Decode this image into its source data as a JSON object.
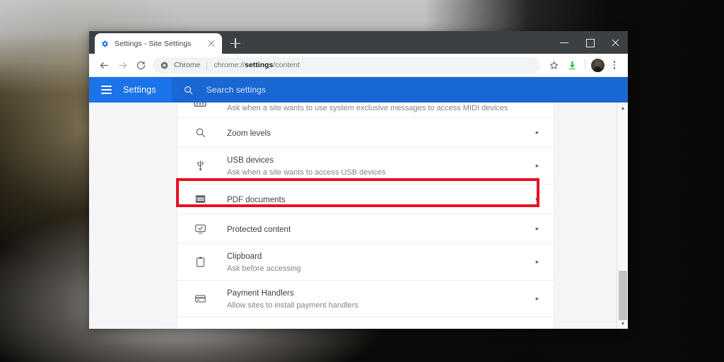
{
  "browser": {
    "tab": {
      "title": "Settings - Site Settings",
      "favicon": "gear-icon",
      "close_label": "×"
    },
    "new_tab_label": "+",
    "window_controls": {
      "minimize": "–",
      "maximize": "□",
      "close": "×"
    },
    "toolbar": {
      "back": "←",
      "forward": "→",
      "reload": "⟳",
      "omnibox": {
        "security_icon": "chrome-info-icon",
        "scheme_label": "Chrome",
        "url_prefix": "chrome://",
        "url_bold": "settings",
        "url_suffix": "/content"
      },
      "bookmark": "☆",
      "downloads": "download-arrow-icon",
      "avatar": "profile-avatar",
      "menu": "three-dot-menu-icon"
    }
  },
  "settings_header": {
    "menu_icon": "hamburger-icon",
    "title": "Settings",
    "search": {
      "icon": "search-icon",
      "placeholder": "Search settings"
    }
  },
  "content": {
    "clipped_row": {
      "icon": "midi-icon",
      "subtitle": "Ask when a site wants to use system exclusive messages to access MIDI devices"
    },
    "rows": [
      {
        "icon": "magnifier-icon",
        "title": "Zoom levels",
        "subtitle": "",
        "chevron": "▸",
        "highlighted": false
      },
      {
        "icon": "usb-icon",
        "title": "USB devices",
        "subtitle": "Ask when a site wants to access USB devices",
        "chevron": "▸",
        "highlighted": false
      },
      {
        "icon": "pdf-icon",
        "title": "PDF documents",
        "subtitle": "",
        "chevron": "▸",
        "highlighted": true
      },
      {
        "icon": "protected-content-icon",
        "title": "Protected content",
        "subtitle": "",
        "chevron": "▸",
        "highlighted": false
      },
      {
        "icon": "clipboard-icon",
        "title": "Clipboard",
        "subtitle": "Ask before accessing",
        "chevron": "▸",
        "highlighted": false
      },
      {
        "icon": "credit-card-icon",
        "title": "Payment Handlers",
        "subtitle": "Allow sites to install payment handlers",
        "chevron": "▸",
        "highlighted": false
      }
    ]
  },
  "scrollbar": {
    "up_arrow": "▲",
    "down_arrow": "▼"
  },
  "annotation": {
    "highlight_color": "#e81123",
    "target": "PDF documents"
  },
  "colors": {
    "settings_blue": "#1a73e8",
    "search_blue": "#1967d2",
    "tabstrip": "#3c4043",
    "text_primary": "#3c4043",
    "text_secondary": "#80868b"
  }
}
